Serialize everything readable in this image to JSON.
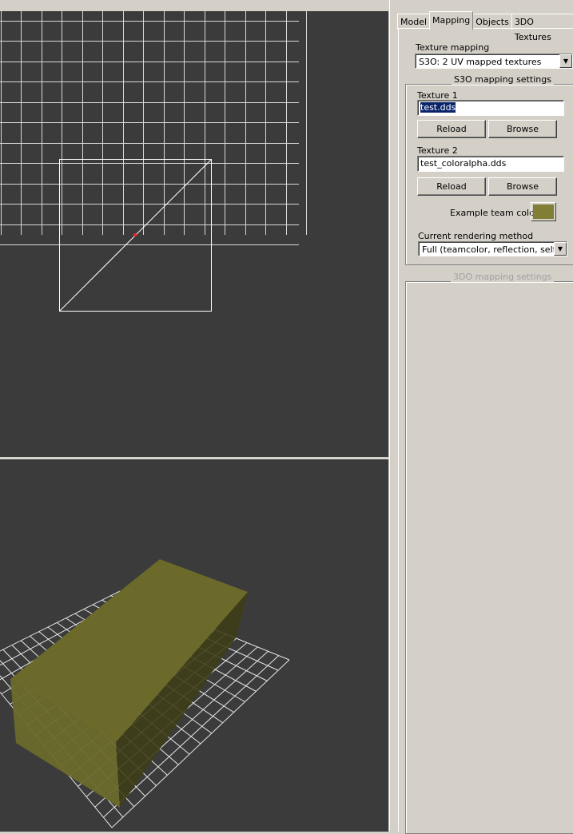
{
  "tabs": [
    {
      "label": "Model"
    },
    {
      "label": "Mapping",
      "active": true
    },
    {
      "label": "Objects"
    },
    {
      "label": "3DO Textures"
    }
  ],
  "mapping": {
    "texture_mapping_label": "Texture mapping",
    "texture_mapping_value": "S3O: 2 UV mapped textures",
    "s3o_group_title": "S3O mapping settings",
    "texture1_label": "Texture 1",
    "texture1_value": "test.dds",
    "texture2_label": "Texture 2",
    "texture2_value": "test_coloralpha.dds",
    "reload_label": "Reload",
    "browse_label": "Browse",
    "team_color_label": "Example team color:",
    "team_color": "#807f35",
    "render_method_label": "Current rendering method",
    "render_method_value": "Full (teamcolor, reflection, self-illumination)",
    "tdo_group_title": "3DO mapping settings"
  },
  "viewports": {
    "background": "#3b3b3b",
    "grid_color": "#d8d8d8",
    "model_color": "#6e6b2c"
  }
}
